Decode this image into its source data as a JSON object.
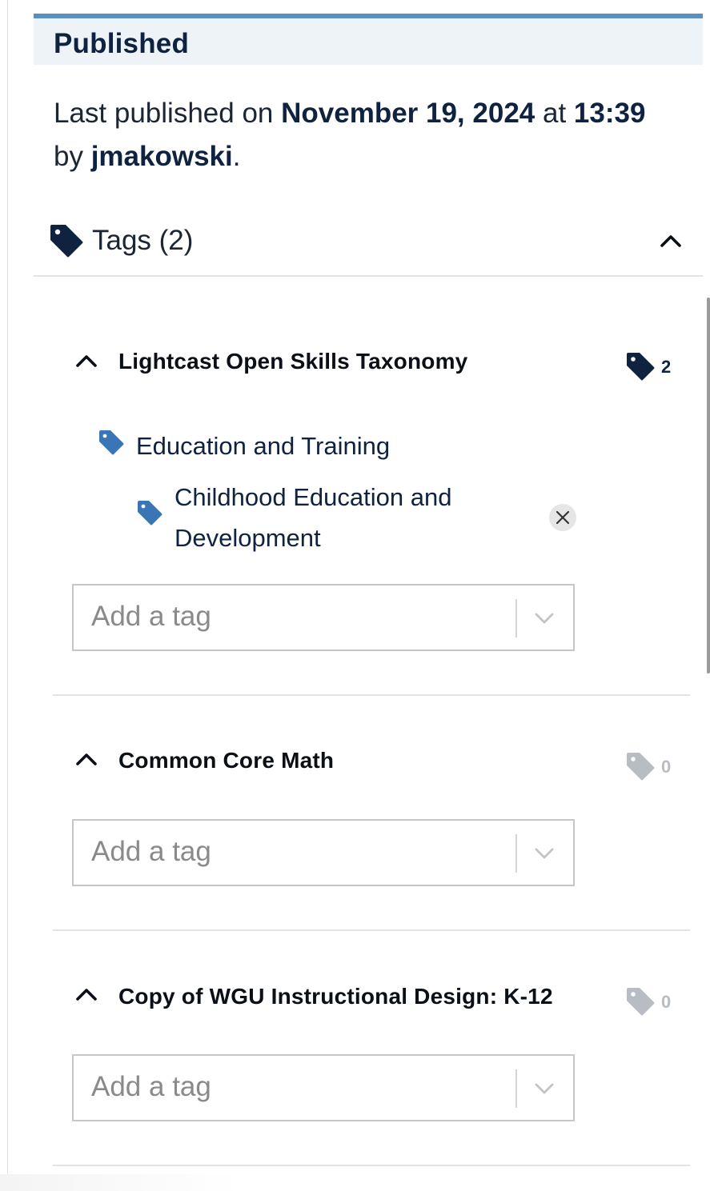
{
  "status": {
    "title": "Published",
    "info_prefix": "Last published on ",
    "date": "November 19, 2024",
    "at_word": " at ",
    "time": "13:39",
    "by_word": "by ",
    "user": "jmakowski",
    "suffix": "."
  },
  "tags": {
    "header_label": "Tags (2)",
    "header_icon": "tag-icon",
    "collapse_icon": "chevron-up-icon"
  },
  "taxonomies": [
    {
      "name": "Lightcast Open Skills Taxonomy",
      "count": "2",
      "applied_tags": [
        {
          "label": "Education and Training",
          "icon": "tag-icon"
        },
        {
          "label_line1": "Childhood Education and",
          "label_line2": "Development",
          "icon": "tag-icon",
          "remove_icon": "close-icon"
        }
      ],
      "input_placeholder": "Add a tag"
    },
    {
      "name": "Common Core Math",
      "count": "0",
      "applied_tags": [],
      "input_placeholder": "Add a tag"
    },
    {
      "name": "Copy of WGU Instructional Design: K-12",
      "count": "0",
      "applied_tags": [],
      "input_placeholder": "Add a tag"
    }
  ],
  "colors": {
    "accent": "#5a90bd",
    "navy": "#0f2240",
    "tag_blue": "#3a76b5",
    "muted": "#b8bdc4"
  }
}
